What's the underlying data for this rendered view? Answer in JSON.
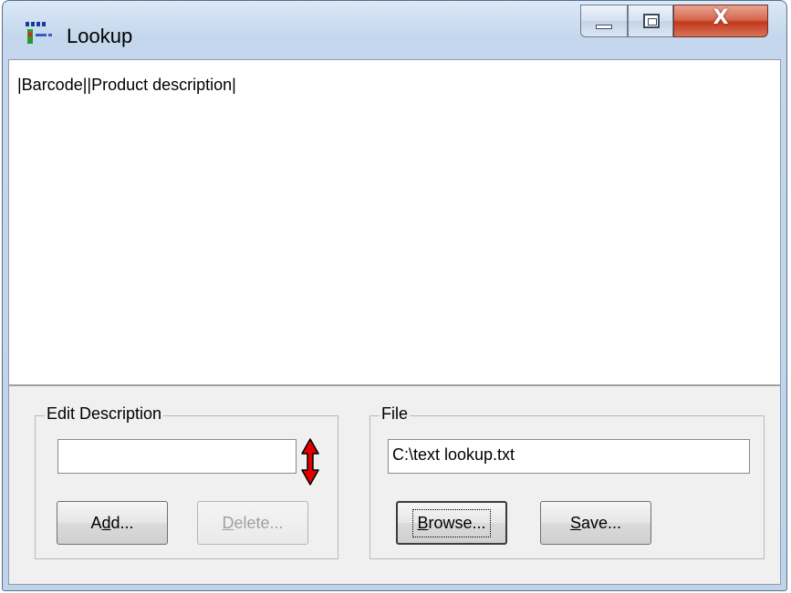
{
  "window": {
    "title": "Lookup"
  },
  "titlebar_buttons": {
    "minimize": "minimize-icon",
    "maximize": "maximize-icon",
    "close_glyph": "X"
  },
  "list": {
    "header": "|Barcode||Product description|"
  },
  "edit_group": {
    "label": "Edit Description",
    "input_value": "",
    "add": {
      "pre": "A",
      "accel": "d",
      "post": "d..."
    },
    "delete": {
      "pre": "",
      "accel": "D",
      "post": "elete..."
    }
  },
  "file_group": {
    "label": "File",
    "path": "C:\\text lookup.txt",
    "browse": {
      "pre": "",
      "accel": "B",
      "post": "rowse..."
    },
    "save": {
      "pre": "",
      "accel": "S",
      "post": "ave..."
    }
  },
  "colors": {
    "arrow_red": "#e00000",
    "close_red": "#c2391c"
  }
}
